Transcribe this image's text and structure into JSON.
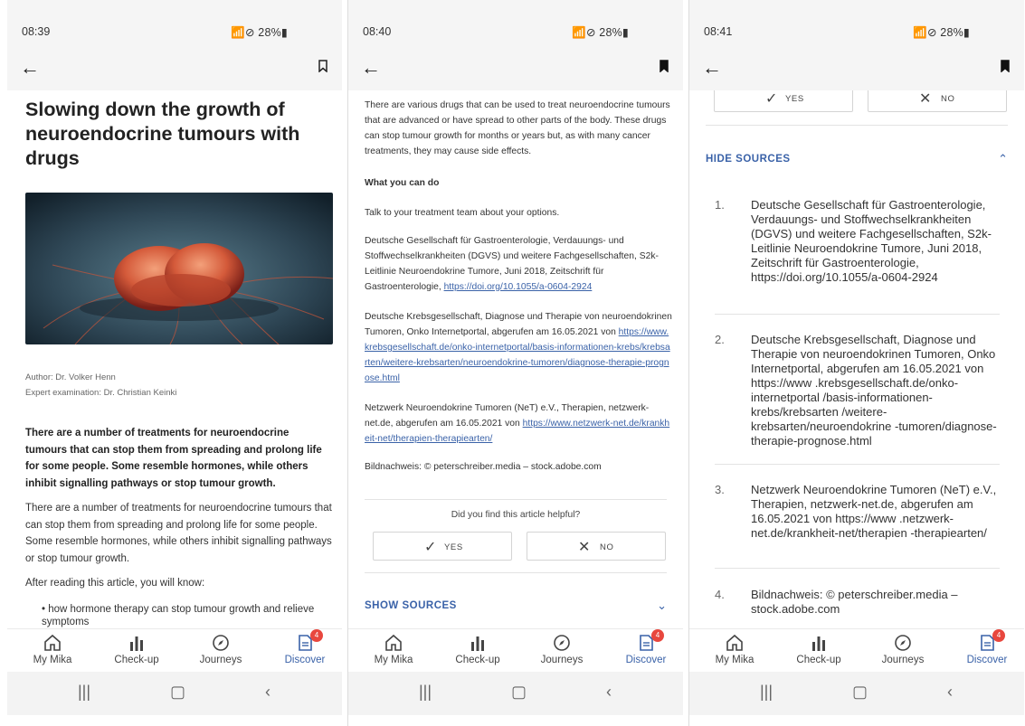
{
  "screens": [
    {
      "time": "08:39",
      "status_right": "📶⊘ 28%▮"
    },
    {
      "time": "08:40",
      "status_right": "📶⊘ 28%▮"
    },
    {
      "time": "08:41",
      "status_right": "📶⊘ 28%▮"
    }
  ],
  "article": {
    "title": "Slowing down the growth of neuroendocrine tumours with drugs",
    "author": "Author: Dr. Volker Henn",
    "expert": "Expert examination: Dr. Christian Keinki",
    "lead": "There are a number of treatments for neuroendocrine tumours that can stop them from spreading and prolong life for some people. Some resemble hormones, while others inhibit signalling pathways or stop tumour growth.",
    "intro": "There are a number of treatments for neuroendocrine tumours that can stop them from spreading and prolong life for some people. Some resemble hormones, while others inhibit signalling pathways or stop tumour growth.",
    "know_heading": "After reading this article, you will know:",
    "bullet1": "• how hormone therapy can stop tumour growth and relieve symptoms"
  },
  "closing": {
    "para": "There are various drugs that can be used to treat neuroendocrine tumours that are advanced or have spread to other parts of the body. These drugs can stop tumour growth for months or years but, as with many cancer treatments, they may cause side effects.",
    "what_heading": "What you can do",
    "what_text": "Talk to your treatment team about your options.",
    "ref1_text": "Deutsche Gesellschaft für Gastroenterologie, Verdauungs- und Stoffwechselkrankheiten (DGVS) und weitere Fachgesellschaften, S2k-Leitlinie Neuroendokrine Tumore, Juni 2018, Zeitschrift für Gastroenterologie, ",
    "ref1_link": "https://doi.org/10.1055/a-0604-2924",
    "ref2_text": "Deutsche Krebsgesellschaft, Diagnose und Therapie von neuroendokrinen Tumoren, Onko Internetportal, abgerufen am 16.05.2021 von ",
    "ref2_link": "https://www.krebsgesellschaft.de/onko-internetportal/basis-informationen-krebs/krebsarten/weitere-krebsarten/neuroendokrine-tumoren/diagnose-therapie-prognose.html",
    "ref3_text": "Netzwerk Neuroendokrine Tumoren (NeT) e.V., Therapien, netzwerk-net.de, abgerufen am 16.05.2021 von ",
    "ref3_link": "https://www.netzwerk-net.de/krankheit-net/therapien-therapiearten/",
    "image_credit": "Bildnachweis: © peterschreiber.media – stock.adobe.com"
  },
  "feedback": {
    "question": "Did you find this article helpful?",
    "yes": "YES",
    "no": "NO"
  },
  "sources": {
    "show_label": "SHOW SOURCES",
    "hide_label": "HIDE SOURCES",
    "items": [
      {
        "num": "1.",
        "text": "Deutsche Gesellschaft für Gastroenterologie, Verdauungs- und Stoffwechselkrankheiten (DGVS) und weitere Fachgesellschaften, S2k-Leitlinie Neuroendokrine Tumore, Juni 2018, Zeitschrift für Gastroenterologie, https://doi.org/10.1055/a-0604-2924"
      },
      {
        "num": "2.",
        "text": "Deutsche Krebsgesellschaft, Diagnose und Therapie von neuroendokrinen Tumoren, Onko Internetportal, abgerufen am 16.05.2021 von https://www .krebsgesellschaft.de/onko-internetportal /basis-informationen-krebs/krebsarten /weitere-krebsarten/neuroendokrine -tumoren/diagnose-therapie-prognose.html"
      },
      {
        "num": "3.",
        "text": "Netzwerk Neuroendokrine Tumoren (NeT) e.V., Therapien, netzwerk-net.de, abgerufen am 16.05.2021 von https://www .netzwerk-net.de/krankheit-net/therapien -therapiearten/"
      },
      {
        "num": "4.",
        "text": "Bildnachweis: © peterschreiber.media – stock.adobe.com"
      }
    ]
  },
  "nav": {
    "items": [
      "My Mika",
      "Check-up",
      "Journeys",
      "Discover"
    ],
    "active": "Discover",
    "badge": "4"
  },
  "icons": {
    "back": "arrow-left-icon",
    "bookmark": "bookmark-icon",
    "home": "home-icon",
    "checkup": "bar-chart-icon",
    "journeys": "compass-icon",
    "discover": "document-icon"
  },
  "colors": {
    "accent": "#3a62a8",
    "badge": "#e8473e",
    "bar_bg": "#f5f5f5"
  }
}
